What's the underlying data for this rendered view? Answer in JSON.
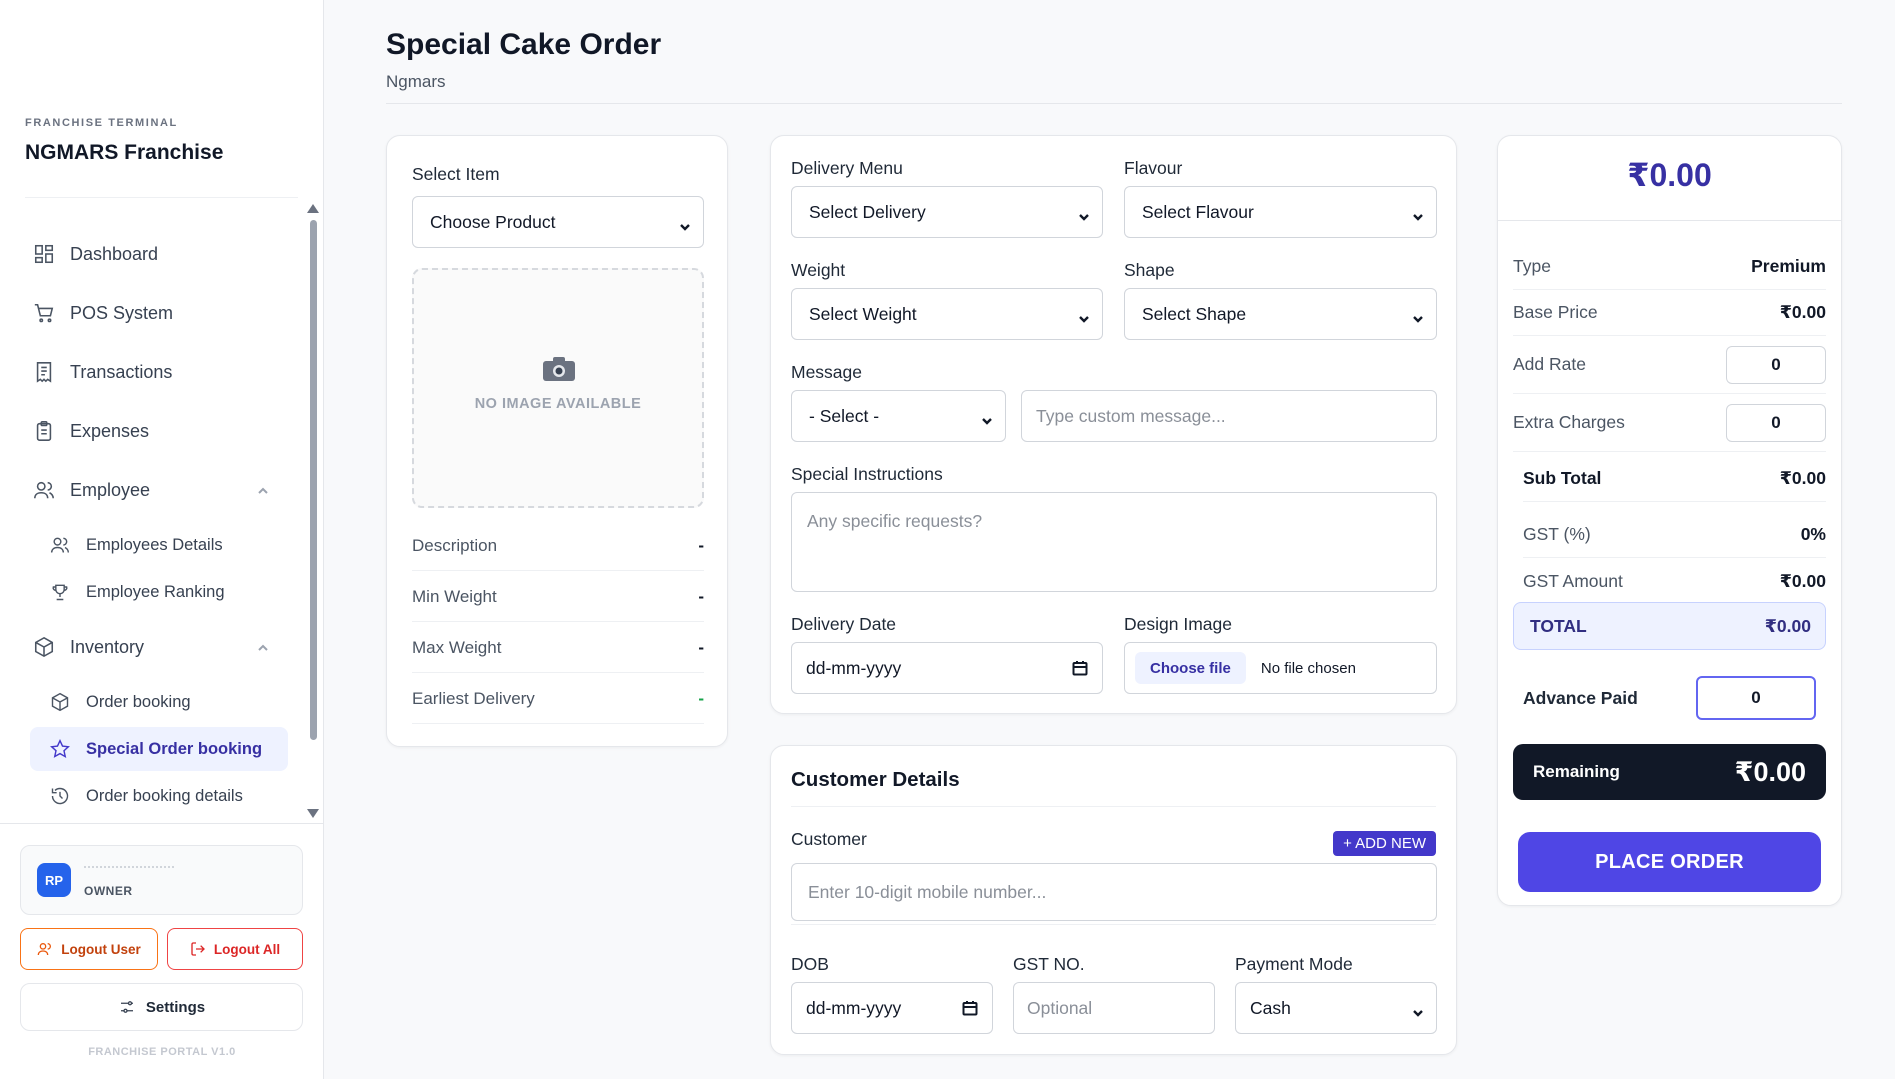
{
  "sidebar": {
    "brand_small": "FRANCHISE TERMINAL",
    "brand_title": "NGMARS Franchise",
    "items": [
      {
        "label": "Dashboard",
        "icon": "grid-icon"
      },
      {
        "label": "POS System",
        "icon": "cart-icon"
      },
      {
        "label": "Transactions",
        "icon": "receipt-icon"
      },
      {
        "label": "Expenses",
        "icon": "clipboard-icon"
      },
      {
        "label": "Employee",
        "icon": "users-icon",
        "expanded": true
      },
      {
        "label": "Employees Details",
        "icon": "users-icon"
      },
      {
        "label": "Employee Ranking",
        "icon": "trophy-icon"
      },
      {
        "label": "Inventory",
        "icon": "box-icon",
        "expanded": true
      },
      {
        "label": "Order booking",
        "icon": "box-icon"
      },
      {
        "label": "Special Order booking",
        "icon": "star-icon",
        "active": true
      },
      {
        "label": "Order booking details",
        "icon": "history-icon"
      }
    ],
    "user": {
      "initials": "RP",
      "role": "OWNER"
    },
    "logout_user": "Logout User",
    "logout_all": "Logout All",
    "settings": "Settings",
    "version": "FRANCHISE PORTAL V1.0"
  },
  "header": {
    "title": "Special Cake Order",
    "subtitle": "Ngmars"
  },
  "product": {
    "select_label": "Select Item",
    "select_value": "Choose Product",
    "no_image": "NO IMAGE AVAILABLE",
    "rows": [
      {
        "label": "Description",
        "value": "-"
      },
      {
        "label": "Min Weight",
        "value": "-"
      },
      {
        "label": "Max Weight",
        "value": "-"
      },
      {
        "label": "Earliest Delivery",
        "value": "-"
      }
    ]
  },
  "order": {
    "delivery_label": "Delivery Menu",
    "delivery_value": "Select Delivery",
    "flavour_label": "Flavour",
    "flavour_value": "Select Flavour",
    "weight_label": "Weight",
    "weight_value": "Select Weight",
    "shape_label": "Shape",
    "shape_value": "Select Shape",
    "message_label": "Message",
    "message_select": "- Select -",
    "message_placeholder": "Type custom message...",
    "instructions_label": "Special Instructions",
    "instructions_placeholder": "Any specific requests?",
    "date_label": "Delivery Date",
    "date_placeholder": "dd-mm-yyyy",
    "design_label": "Design Image",
    "choose_file": "Choose file",
    "file_status": "No file chosen"
  },
  "customer": {
    "title": "Customer Details",
    "customer_label": "Customer",
    "add_new": "+ ADD NEW",
    "mobile_placeholder": "Enter 10-digit mobile number...",
    "dob_label": "DOB",
    "dob_placeholder": "dd-mm-yyyy",
    "gst_label": "GST NO.",
    "gst_placeholder": "Optional",
    "payment_label": "Payment Mode",
    "payment_value": "Cash"
  },
  "summary": {
    "amount": "₹0.00",
    "type_label": "Type",
    "type_value": "Premium",
    "base_label": "Base Price",
    "base_value": "₹0.00",
    "add_rate_label": "Add Rate",
    "add_rate_value": "0",
    "extra_label": "Extra Charges",
    "extra_value": "0",
    "subtotal_label": "Sub Total",
    "subtotal_value": "₹0.00",
    "gst_label": "GST (%)",
    "gst_value": "0%",
    "gst_amount_label": "GST Amount",
    "gst_amount_value": "₹0.00",
    "total_label": "TOTAL",
    "total_value": "₹0.00",
    "advance_label": "Advance Paid",
    "advance_value": "0",
    "remaining_label": "Remaining",
    "remaining_value": "₹0.00",
    "place_order": "PLACE ORDER"
  },
  "colors": {
    "accent": "#4f46e5",
    "dark": "#111827",
    "logout": "#f97316",
    "danger": "#ef4444"
  }
}
